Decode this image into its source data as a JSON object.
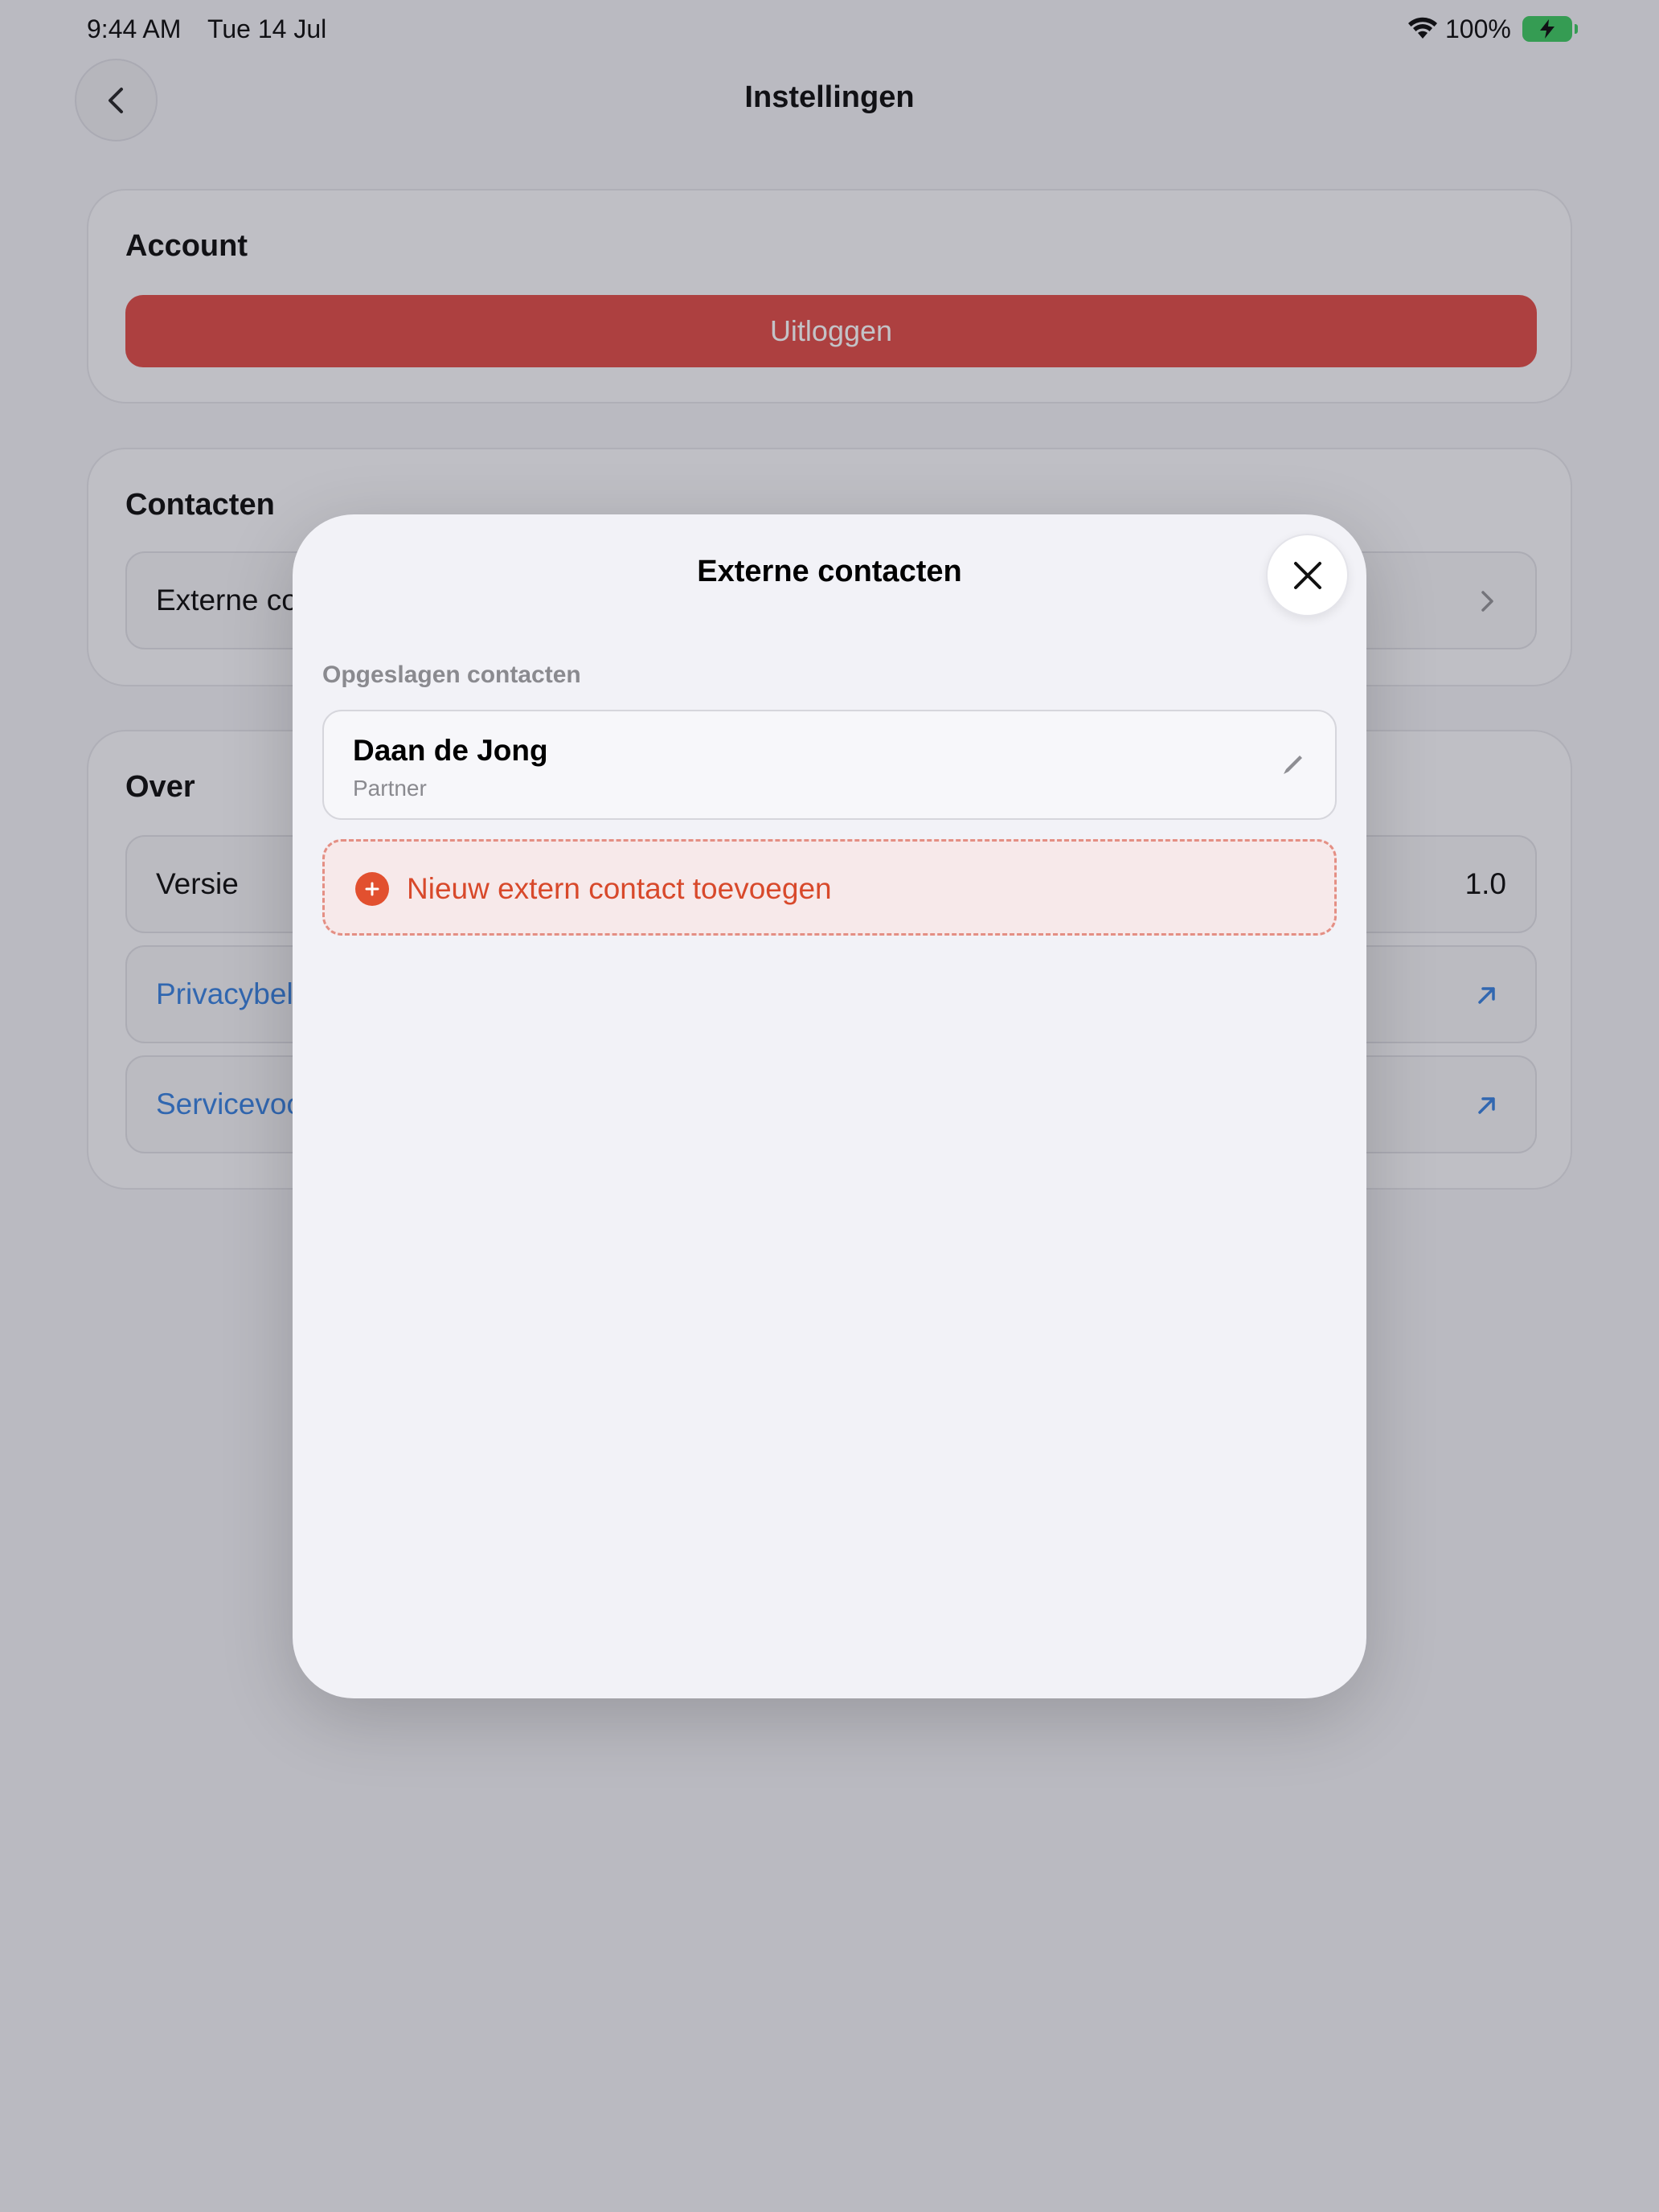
{
  "status_bar": {
    "time": "9:44 AM",
    "date": "Tue 14 Jul",
    "battery_percent": "100%"
  },
  "nav": {
    "title": "Instellingen"
  },
  "account": {
    "title": "Account",
    "logout_label": "Uitloggen"
  },
  "contacts_section": {
    "title": "Contacten",
    "row_label": "Externe co"
  },
  "about": {
    "title": "Over",
    "version_label": "Versie",
    "version_value": "1.0",
    "privacy_label": "Privacybel",
    "terms_label": "Servicevoo"
  },
  "modal": {
    "title": "Externe contacten",
    "section_label": "Opgeslagen contacten",
    "contacts": [
      {
        "name": "Daan de Jong",
        "role": "Partner"
      }
    ],
    "add_label": "Nieuw extern contact toevoegen"
  },
  "colors": {
    "logout_red": "#e0443e",
    "link_blue": "#2f7bde",
    "add_accent": "#e2502f",
    "battery_green": "#34c759"
  }
}
